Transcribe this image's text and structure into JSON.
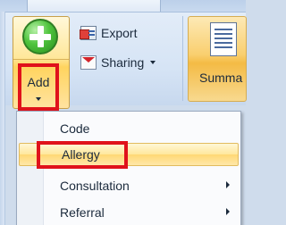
{
  "ribbon": {
    "add_button": {
      "label": "Add",
      "icon": "add-icon"
    },
    "export_button": {
      "label": "Export",
      "icon": "export-icon"
    },
    "sharing_button": {
      "label": "Sharing",
      "icon": "sharing-icon"
    },
    "summary_button": {
      "label": "Summa",
      "icon": "summary-icon"
    }
  },
  "add_menu": {
    "items": [
      {
        "label": "Code",
        "submenu": false
      },
      {
        "label": "Allergy",
        "submenu": false,
        "highlighted": true
      },
      {
        "label": "Consultation",
        "submenu": true
      },
      {
        "label": "Referral",
        "submenu": true
      }
    ]
  },
  "colors": {
    "highlight_border": "#e0121b",
    "ribbon_background": "#dce8f6",
    "hover_gold": "#ffd874"
  }
}
